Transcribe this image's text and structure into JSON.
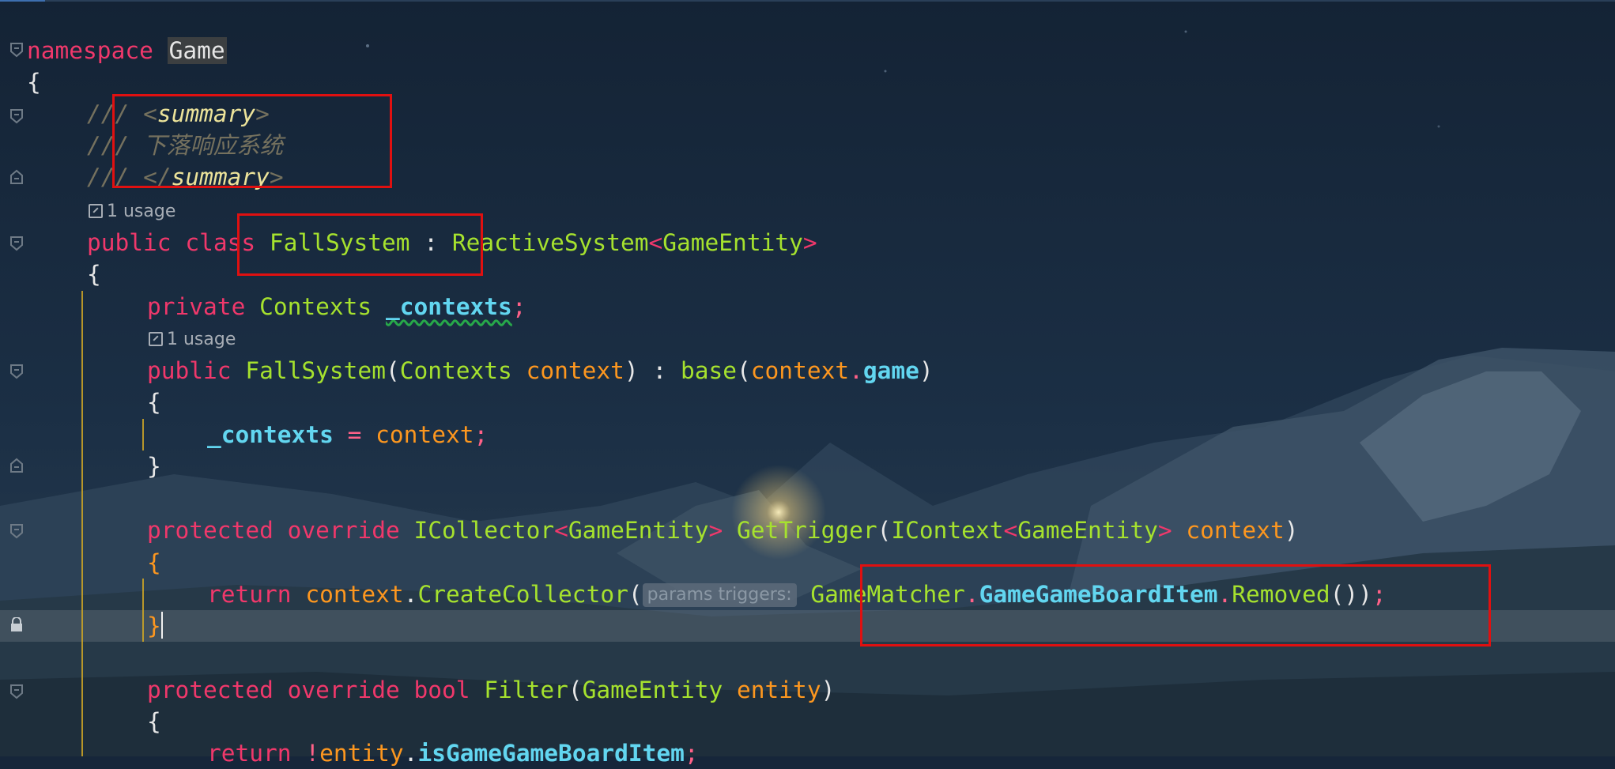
{
  "code": {
    "namespace_kw": "namespace",
    "namespace_name": "Game",
    "brace_open": "{",
    "brace_close": "}",
    "doc_prefix": "///",
    "doc_summary_open_lt": "<",
    "doc_summary_tag": "summary",
    "doc_summary_open_gt": ">",
    "doc_text": "下落响应系统",
    "doc_summary_close_lt": "</",
    "usage_hint_1": "1 usage",
    "usage_hint_2": "1 usage",
    "kw_public": "public",
    "kw_class": "class",
    "class_name": "FallSystem",
    "colon": ":",
    "base_type": "ReactiveSystem",
    "generic_arg": "GameEntity",
    "kw_private": "private",
    "contexts_type": "Contexts",
    "field_contexts": "_contexts",
    "semicolon": ";",
    "ctor_name": "FallSystem",
    "param_context": "context",
    "kw_base": "base",
    "member_game": "game",
    "assign": "=",
    "kw_protected": "protected",
    "kw_override": "override",
    "icollector": "ICollector",
    "get_trigger": "GetTrigger",
    "icontext": "IContext",
    "kw_return": "return",
    "create_collector": "CreateCollector",
    "inlay_hint": "params triggers:",
    "game_matcher": "GameMatcher",
    "game_board_item": "GameGameBoardItem",
    "removed": "Removed",
    "kw_bool": "bool",
    "filter": "Filter",
    "param_entity": "entity",
    "not_op": "!",
    "is_board_item": "isGameGameBoardItem"
  }
}
